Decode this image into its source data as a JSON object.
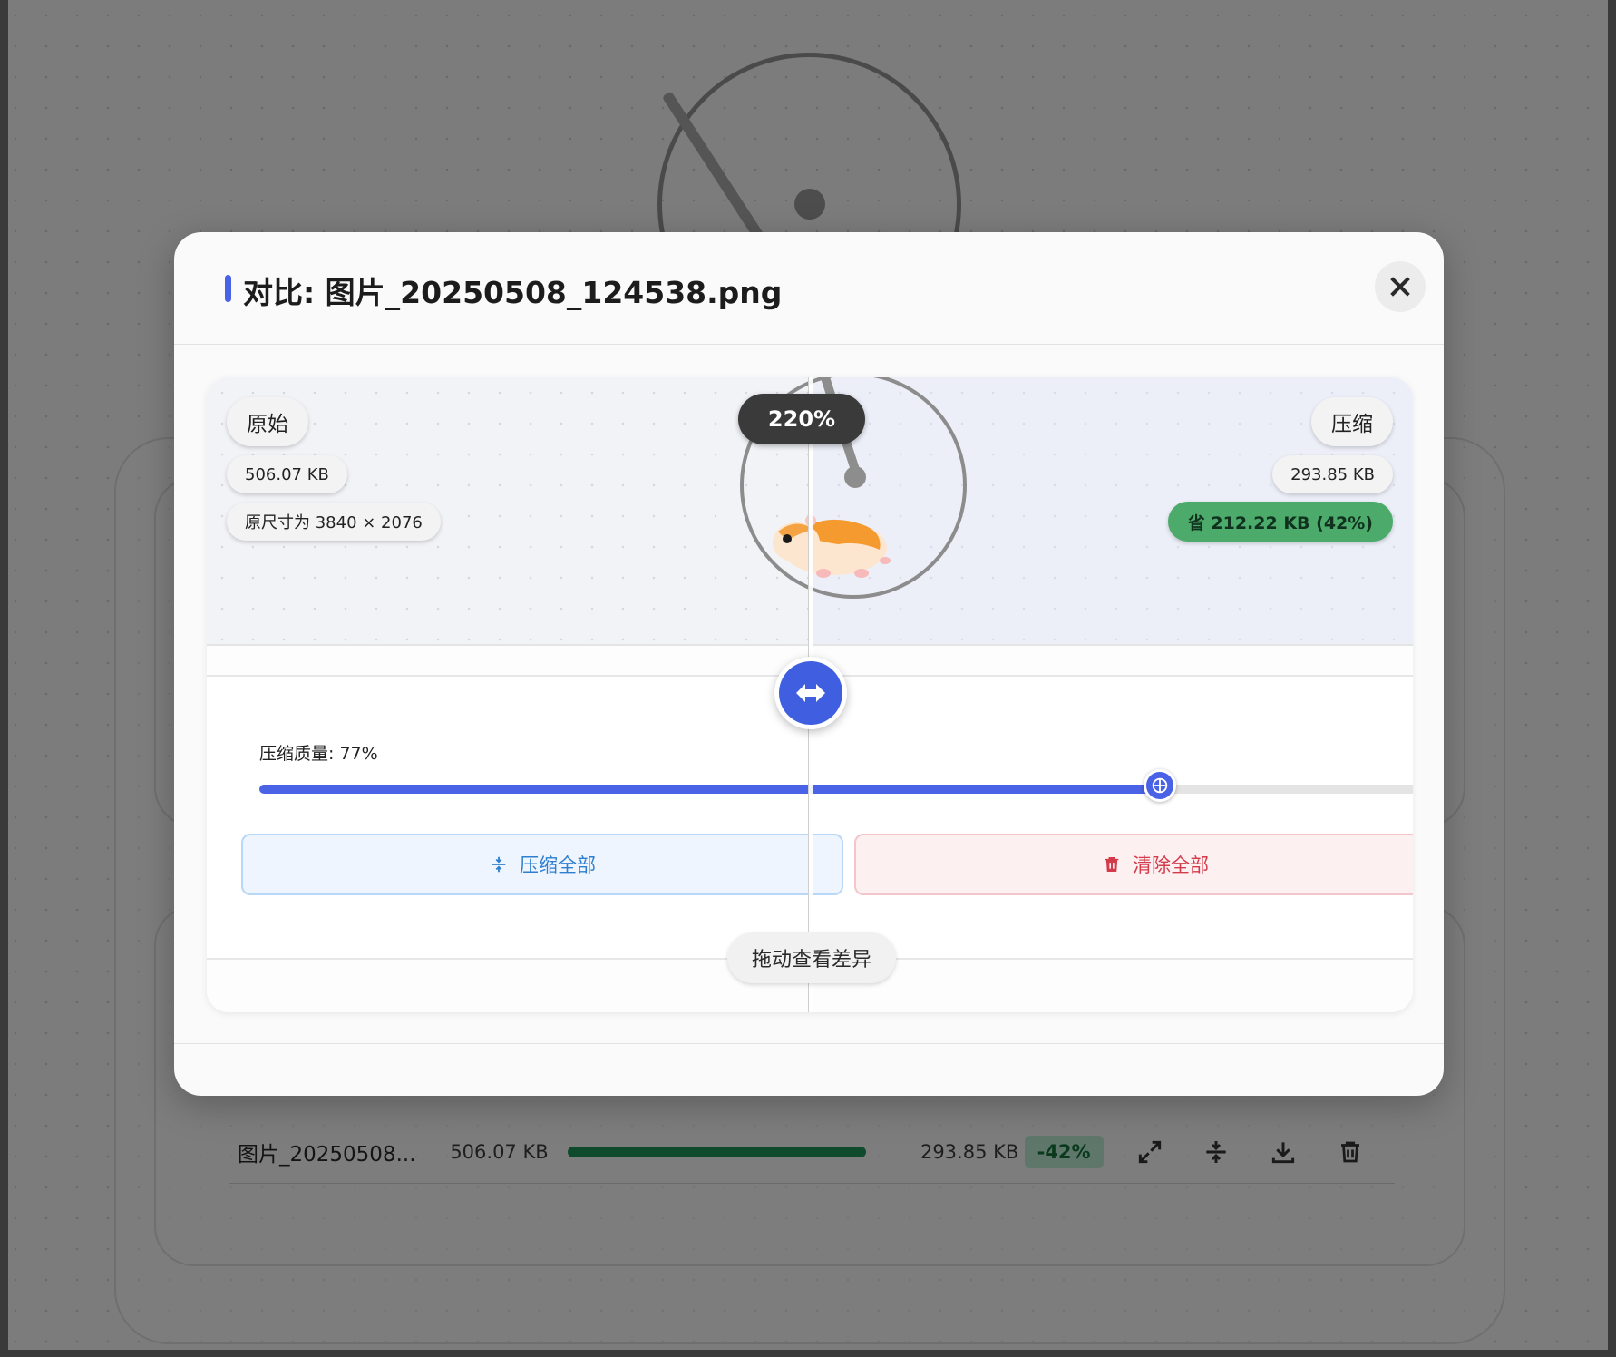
{
  "background": {
    "file_row": {
      "name": "图片_20250508...",
      "original_size": "506.07 KB",
      "progress": 1.0,
      "compressed_size": "293.85 KB",
      "saving_badge": "-42%",
      "icons": [
        "expand-icon",
        "compress-icon",
        "download-icon",
        "trash-icon"
      ]
    }
  },
  "modal": {
    "title": "对比: 图片_20250508_124538.png",
    "close_icon": "close-icon",
    "accent_color": "#4a63e6",
    "compare": {
      "left_label": "原始",
      "left_size": "506.07 KB",
      "left_dimensions": "原尺寸为 3840 × 2076",
      "right_label": "压缩",
      "right_size": "293.85 KB",
      "saving": "省 212.22 KB (42%)",
      "zoom": "220%",
      "divider_position": 0.5,
      "hint": "拖动查看差异"
    },
    "controls": {
      "quality_label": "压缩质量: 77%",
      "quality_value": 77,
      "compress_all_label": "压缩全部",
      "clear_all_label": "清除全部"
    }
  }
}
